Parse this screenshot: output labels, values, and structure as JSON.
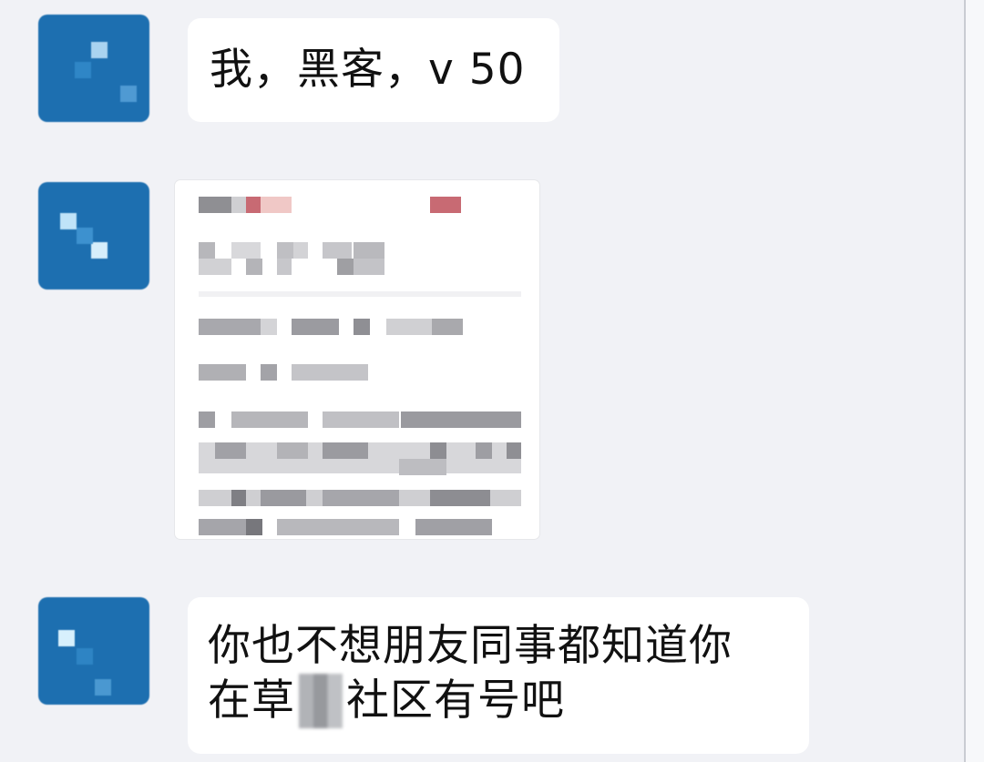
{
  "messages": [
    {
      "avatar": "blurred-profile",
      "text": "我，黑客，v 50"
    },
    {
      "avatar": "blurred-profile",
      "image": "pixelated-screenshot"
    },
    {
      "avatar": "blurred-profile",
      "line1": "你也不想朋友同事都知道你",
      "line2_start": "在草",
      "line2_end": "社区有号吧"
    }
  ],
  "colors": {
    "chat_background": "#f1f2f6",
    "bubble": "#ffffff",
    "avatar": "#1d6fb0",
    "text": "#111111"
  }
}
